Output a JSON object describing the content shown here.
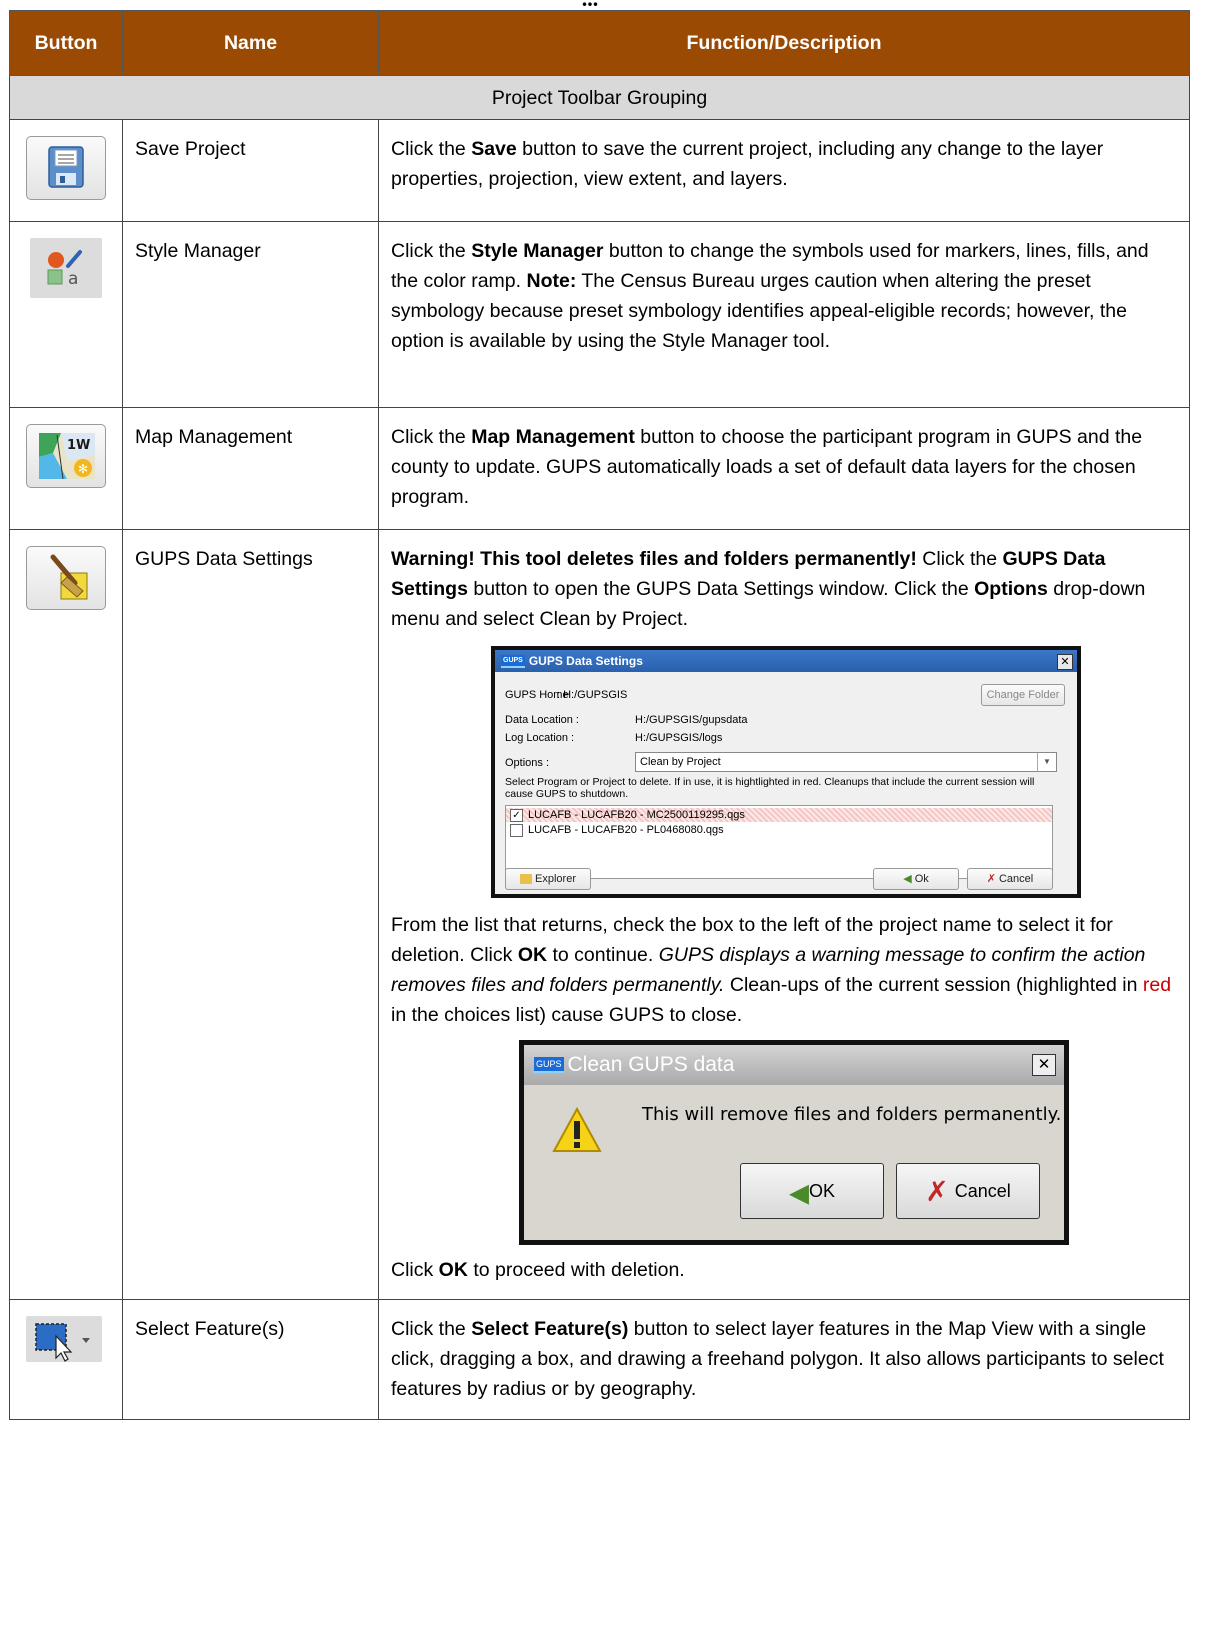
{
  "caption": "...",
  "table": {
    "headers": [
      "Button",
      "Name",
      "Function/Description"
    ],
    "group_label": "Project Toolbar Grouping",
    "rows": [
      {
        "icon": "save-project-icon",
        "name": "Save Project",
        "desc": {
          "p1": "Click the ",
          "b1": "Save",
          "p2": " button to save the current project, including any change to the layer properties, projection, view extent, and layers."
        }
      },
      {
        "icon": "style-manager-icon",
        "name": "Style Manager",
        "desc": {
          "p1": "Click the ",
          "b1": "Style Manager",
          "p2": " button to change the symbols used for markers, lines, fills, and the color ramp. ",
          "b2": "Note:",
          "p3": " The Census Bureau urges caution when altering the preset symbology because preset symbology identifies appeal-eligible records; however, the option is available by using the Style Manager tool."
        }
      },
      {
        "icon": "map-management-icon",
        "name": "Map Management",
        "desc": {
          "p1": "Click the ",
          "b1": "Map Management",
          "p2": " button to choose the participant program in GUPS and the county to update. GUPS automatically loads a set of default data layers for the chosen program."
        }
      },
      {
        "icon": "gups-data-settings-icon",
        "name": "GUPS Data Settings",
        "desc": {
          "b0": "Warning! This tool deletes files and folders permanently!",
          "p1": " Click the ",
          "b1": "GUPS Data Settings",
          "p2": " button to open the GUPS Data Settings window. Click the ",
          "b2": "Options",
          "p3": " drop-down menu and select Clean by Project.",
          "q1": "From the list that returns, check the box to the left of the project name to select it for deletion. Click ",
          "qb": "OK",
          "q2": " to continue. ",
          "qi": "GUPS displays a warning message to confirm the action removes files and folders permanently.",
          "q3": " Clean-ups of the current session (highlighted in ",
          "qred": "red",
          "q4": " in the choices list) cause GUPS to close.",
          "r1": "Click ",
          "rb": "OK",
          "r2": " to proceed with deletion."
        }
      },
      {
        "icon": "select-features-icon",
        "name": "Select Feature(s)",
        "desc": {
          "p1": "Click the ",
          "b1": "Select Feature(s)",
          "p2": " button to select layer features in the Map View with a single click, dragging a box, and drawing a freehand polygon. It also allows participants to select features by radius or by geography."
        }
      }
    ]
  },
  "settings_dialog": {
    "logo": "GUPS",
    "title": "GUPS Data Settings",
    "home_label": "GUPS Home",
    "home_value": ": H:/GUPSGIS",
    "change_folder": "Change Folder",
    "data_label": "Data Location :",
    "data_value": "H:/GUPSGIS/gupsdata",
    "log_label": "Log Location :",
    "log_value": "H:/GUPSGIS/logs",
    "options_label": "Options :",
    "options_value": "Clean by Project",
    "instructions": "Select Program or Project to delete. If in use, it is hightlighted in red. Cleanups that include the current session will cause GUPS to shutdown.",
    "items": [
      "LUCAFB - LUCAFB20 - MC2500119295.qgs",
      "LUCAFB - LUCAFB20 - PL0468080.qgs"
    ],
    "explorer_button": "Explorer",
    "ok_button": "Ok",
    "cancel_button": "Cancel"
  },
  "confirm_dialog": {
    "logo": "GUPS",
    "title": "Clean GUPS data",
    "message": "This will remove files and folders permanently.",
    "ok_button": "OK",
    "cancel_button": "Cancel"
  }
}
